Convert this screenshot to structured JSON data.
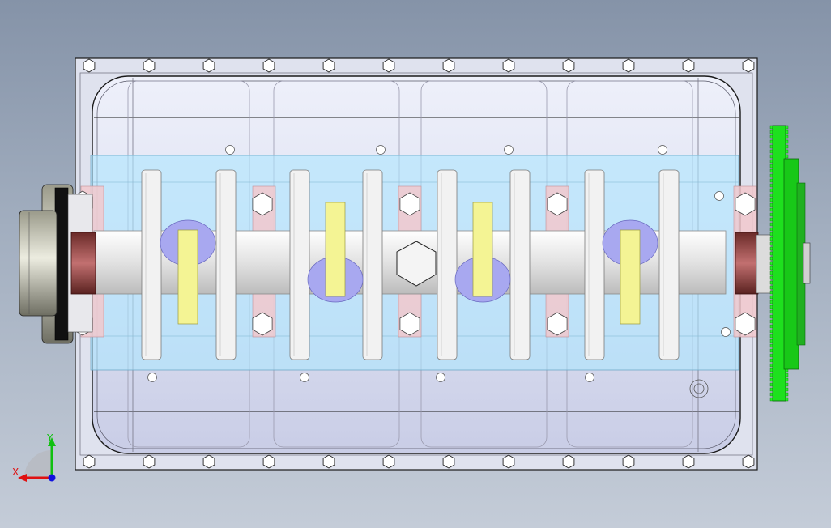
{
  "viewport": {
    "background_top": "#8593a8",
    "background_bottom": "#c4ccd8"
  },
  "model": {
    "housing_fill": "#dfe3f0",
    "housing_edge": "#1a1a1a",
    "coolant_fill": "#aee6ff",
    "shaft_fill": "#e6e6e6",
    "bearing_fill": "#f0f090",
    "journal_fill": "#a8a8f0",
    "seal_fill": "#9c4a48",
    "gear_fill": "#1ee01e",
    "pulley_fill": "#c8c8b8"
  },
  "triad": {
    "x_label": "X",
    "y_label": "Y",
    "x_color": "#e01010",
    "y_color": "#10c010",
    "z_color": "#1010e0"
  }
}
